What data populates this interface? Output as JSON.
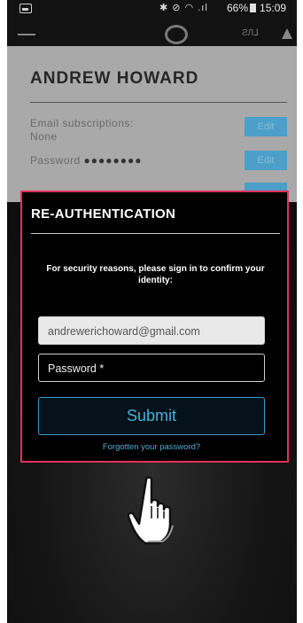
{
  "status_bar": {
    "icons": "✱ ⊘ ◠ .ıl",
    "battery_pct": "66%",
    "time": "15:09"
  },
  "account": {
    "name": "ANDREW HOWARD",
    "email_subscriptions_label": "Email subscriptions:",
    "email_subscriptions_value": "None",
    "password_label": "Password",
    "password_mask": "●●●●●●●●",
    "edit_label": "Edit"
  },
  "modal": {
    "title": "RE-AUTHENTICATION",
    "message": "For security reasons, please sign in to confirm your identity:",
    "email_value": "andrewerichoward@gmail.com",
    "password_placeholder": "Password *",
    "submit_label": "Submit",
    "forgot_label": "Forgotten your password?"
  },
  "colors": {
    "highlight_border": "#e5315c",
    "accent": "#47b0da"
  }
}
